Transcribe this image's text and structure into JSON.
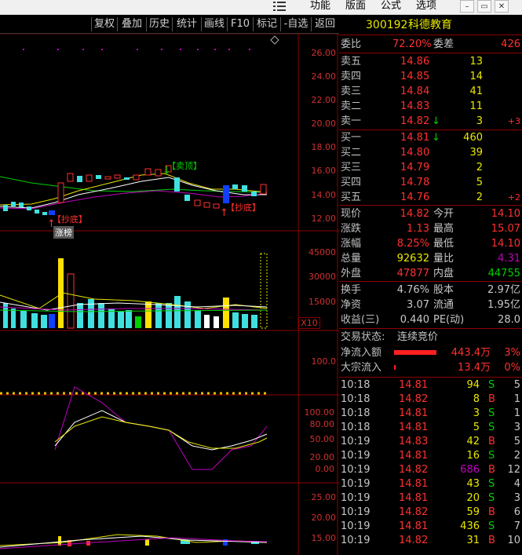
{
  "menu": {
    "function": "功能",
    "layout": "版面",
    "formula": "公式",
    "options": "选项"
  },
  "toolbar": [
    "复权",
    "叠加",
    "历史",
    "统计",
    "画线",
    "F10",
    "标记",
    "-自选",
    "返回"
  ],
  "price_axis": [
    "26.00",
    "24.00",
    "22.00",
    "20.00",
    "18.00",
    "16.00",
    "14.00",
    "12.00"
  ],
  "volume_axis": [
    "45000",
    "30000",
    "15000"
  ],
  "volume_unit": "X10",
  "indicator1_axis": [
    "100.0"
  ],
  "kdj_axis": [
    "100.00",
    "80.00",
    "50.00",
    "20.00",
    "0.00"
  ],
  "lower_axis": [
    "25.00",
    "20.00",
    "15.00"
  ],
  "markers": {
    "sell_top": "【卖顶】",
    "buy_bottom_1": "【抄底】",
    "buy_bottom_2": "【抄底】",
    "limit_up": "涨榜"
  },
  "stock": {
    "code": "300192",
    "name": "科德教育"
  },
  "commission": {
    "ratio_label": "委比",
    "ratio_value": "72.20%",
    "diff_label": "委差",
    "diff_value": "426"
  },
  "asks": [
    {
      "label": "卖五",
      "price": "14.86",
      "vol": "13",
      "chg": "",
      "arrow": ""
    },
    {
      "label": "卖四",
      "price": "14.85",
      "vol": "14",
      "chg": "",
      "arrow": ""
    },
    {
      "label": "卖三",
      "price": "14.84",
      "vol": "41",
      "chg": "",
      "arrow": ""
    },
    {
      "label": "卖二",
      "price": "14.83",
      "vol": "11",
      "chg": "",
      "arrow": ""
    },
    {
      "label": "卖一",
      "price": "14.82",
      "vol": "3",
      "chg": "+3",
      "arrow": "↓"
    }
  ],
  "bids": [
    {
      "label": "买一",
      "price": "14.81",
      "vol": "460",
      "chg": "",
      "arrow": "↓"
    },
    {
      "label": "买二",
      "price": "14.80",
      "vol": "39",
      "chg": "",
      "arrow": ""
    },
    {
      "label": "买三",
      "price": "14.79",
      "vol": "2",
      "chg": "",
      "arrow": ""
    },
    {
      "label": "买四",
      "price": "14.78",
      "vol": "5",
      "chg": "",
      "arrow": ""
    },
    {
      "label": "买五",
      "price": "14.76",
      "vol": "2",
      "chg": "+2",
      "arrow": ""
    }
  ],
  "quote": [
    {
      "l1": "现价",
      "v1": "14.82",
      "c1": "red",
      "l2": "今开",
      "v2": "14.10",
      "c2": "red"
    },
    {
      "l1": "涨跌",
      "v1": "1.13",
      "c1": "red",
      "l2": "最高",
      "v2": "15.07",
      "c2": "red"
    },
    {
      "l1": "涨幅",
      "v1": "8.25%",
      "c1": "red",
      "l2": "最低",
      "v2": "14.10",
      "c2": "red"
    },
    {
      "l1": "总量",
      "v1": "92632",
      "c1": "yellow",
      "l2": "量比",
      "v2": "4.31",
      "c2": "purple"
    },
    {
      "l1": "外盘",
      "v1": "47877",
      "c1": "red",
      "l2": "内盘",
      "v2": "44755",
      "c2": "green"
    }
  ],
  "fundamentals": [
    {
      "l1": "换手",
      "v1": "4.76%",
      "l2": "股本",
      "v2": "2.97亿"
    },
    {
      "l1": "净资",
      "v1": "3.07",
      "l2": "流通",
      "v2": "1.95亿"
    },
    {
      "l1": "收益(三)",
      "v1": "0.440",
      "l2": "PE(动)",
      "v2": "28.0"
    }
  ],
  "trade_status": {
    "label": "交易状态:",
    "value": "连续竞价"
  },
  "flows": [
    {
      "label": "净流入额",
      "value": "443.4万",
      "pct": "3%"
    },
    {
      "label": "大宗流入",
      "value": "13.4万",
      "pct": "0%"
    }
  ],
  "ticks": [
    {
      "time": "10:18",
      "price": "14.81",
      "vol": "94",
      "bs": "S",
      "n": "5"
    },
    {
      "time": "10:18",
      "price": "14.82",
      "vol": "8",
      "bs": "B",
      "n": "1"
    },
    {
      "time": "10:18",
      "price": "14.81",
      "vol": "3",
      "bs": "S",
      "n": "1"
    },
    {
      "time": "10:18",
      "price": "14.81",
      "vol": "5",
      "bs": "S",
      "n": "3"
    },
    {
      "time": "10:19",
      "price": "14.83",
      "vol": "42",
      "bs": "B",
      "n": "5"
    },
    {
      "time": "10:19",
      "price": "14.81",
      "vol": "16",
      "bs": "S",
      "n": "2"
    },
    {
      "time": "10:19",
      "price": "14.82",
      "vol": "686",
      "bs": "B",
      "n": "12"
    },
    {
      "time": "10:19",
      "price": "14.81",
      "vol": "43",
      "bs": "S",
      "n": "4"
    },
    {
      "time": "10:19",
      "price": "14.81",
      "vol": "20",
      "bs": "S",
      "n": "3"
    },
    {
      "time": "10:19",
      "price": "14.82",
      "vol": "59",
      "bs": "B",
      "n": "6"
    },
    {
      "time": "10:19",
      "price": "14.81",
      "vol": "436",
      "bs": "S",
      "n": "7"
    },
    {
      "time": "10:19",
      "price": "14.82",
      "vol": "31",
      "bs": "B",
      "n": "10"
    }
  ],
  "colors": {
    "up": "#ff3030",
    "down": "#00d000",
    "cyan": "#40e0e0",
    "yellow": "#e8e800",
    "purple": "#c000c0",
    "border": "#8b0000"
  }
}
